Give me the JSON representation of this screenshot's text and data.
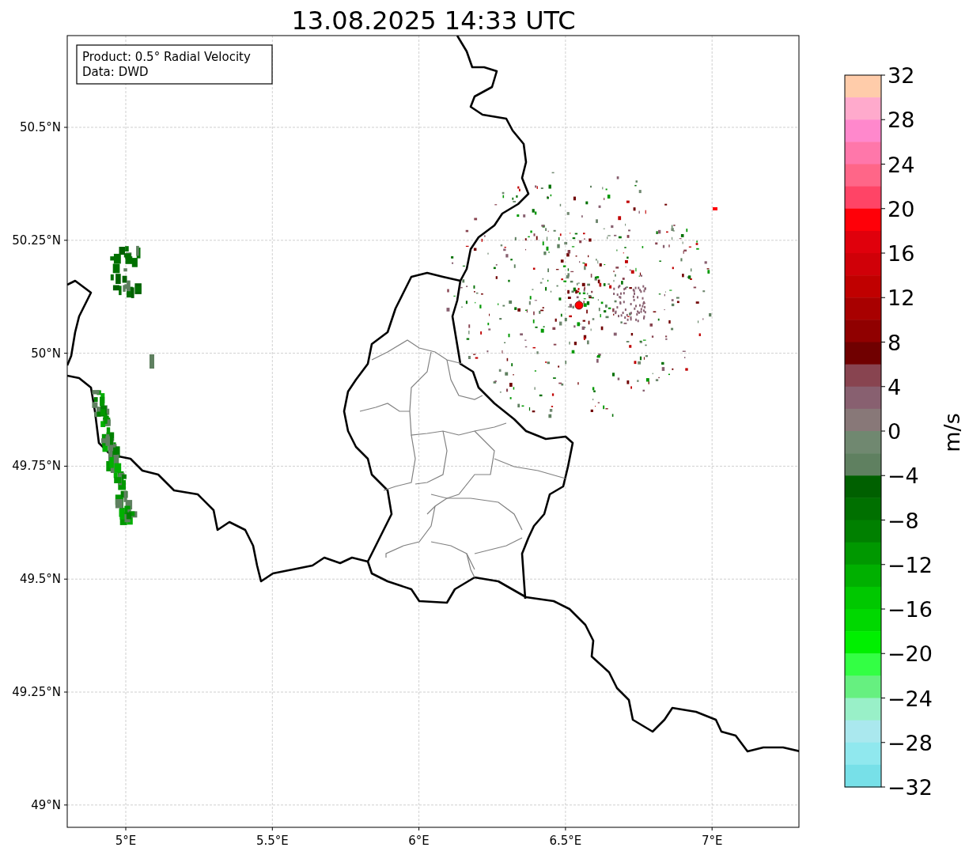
{
  "title": "13.08.2025 14:33 UTC",
  "info_box": [
    "Product: 0.5° Radial Velocity",
    "Data: DWD"
  ],
  "map": {
    "lat_ticks": [
      "50.5°N",
      "50.25°N",
      "50°N",
      "49.75°N",
      "49.5°N",
      "49.25°N",
      "49°N"
    ],
    "lon_ticks": [
      "5°E",
      "5.5°E",
      "6°E",
      "6.5°E",
      "7°E"
    ]
  },
  "colorbar": {
    "label": "m/s",
    "ticks": [
      "32",
      "28",
      "24",
      "20",
      "16",
      "12",
      "8",
      "4",
      "0",
      "−4",
      "−8",
      "−12",
      "−16",
      "−20",
      "−24",
      "−28",
      "−32"
    ],
    "bands": [
      {
        "color": "#ffccaa"
      },
      {
        "color": "#ffaacc"
      },
      {
        "color": "#ff88cc"
      },
      {
        "color": "#ff77aa"
      },
      {
        "color": "#ff6688"
      },
      {
        "color": "#ff4466"
      },
      {
        "color": "#ff0008"
      },
      {
        "color": "#e0000c"
      },
      {
        "color": "#d00008"
      },
      {
        "color": "#c00000"
      },
      {
        "color": "#a80000"
      },
      {
        "color": "#900000"
      },
      {
        "color": "#700000"
      },
      {
        "color": "#884450"
      },
      {
        "color": "#886070"
      },
      {
        "color": "#887878"
      },
      {
        "color": "#708870"
      },
      {
        "color": "#5f8060"
      },
      {
        "color": "#006000"
      },
      {
        "color": "#007000"
      },
      {
        "color": "#008000"
      },
      {
        "color": "#009800"
      },
      {
        "color": "#00b000"
      },
      {
        "color": "#00c800"
      },
      {
        "color": "#00d800"
      },
      {
        "color": "#00f000"
      },
      {
        "color": "#33ff44"
      },
      {
        "color": "#66f080"
      },
      {
        "color": "#99f0c8"
      },
      {
        "color": "#aae8ee"
      },
      {
        "color": "#90e8ee"
      },
      {
        "color": "#77e0e8"
      }
    ]
  }
}
